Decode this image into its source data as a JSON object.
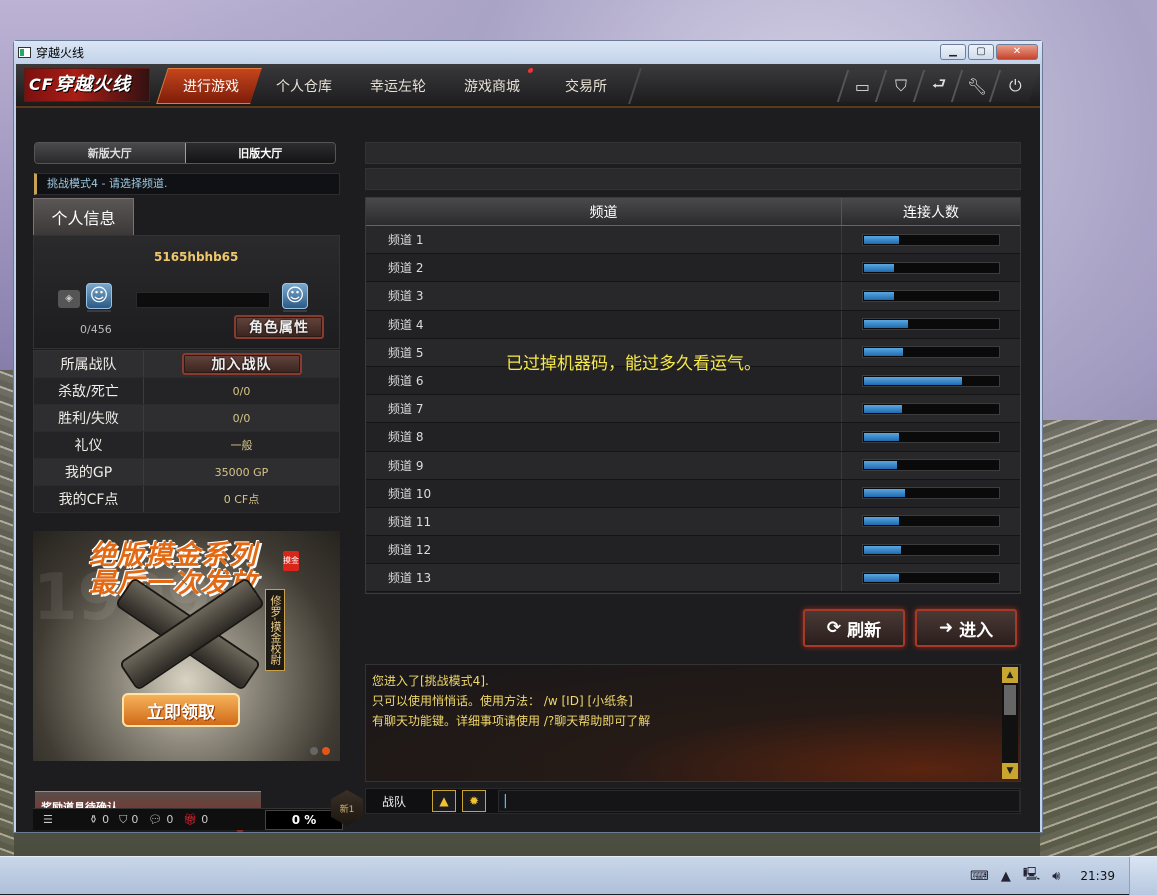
{
  "window": {
    "title": "穿越火线"
  },
  "nav": {
    "logo": "穿越火线",
    "tabs": [
      {
        "label": "进行游戏",
        "active": true
      },
      {
        "label": "个人仓库"
      },
      {
        "label": "幸运左轮"
      },
      {
        "label": "游戏商城",
        "badge": true
      },
      {
        "label": "交易所"
      }
    ],
    "icons": [
      "tv-icon",
      "shield-icon",
      "return-icon",
      "wrench-icon",
      "power-icon"
    ]
  },
  "lobby": {
    "new": "新版大厅",
    "old": "旧版大厅"
  },
  "mode_hint": "挑战模式4 - 请选择频道.",
  "profile": {
    "header": "个人信息",
    "name": "5165hbhb65",
    "xp": "0/456",
    "role_button": "角色属性"
  },
  "stats": {
    "team_label": "所属战队",
    "join_team": "加入战队",
    "rows": [
      {
        "k": "杀敌/死亡",
        "v": "0/0"
      },
      {
        "k": "胜利/失败",
        "v": "0/0"
      },
      {
        "k": "礼仪",
        "v": "一般"
      },
      {
        "k": "我的GP",
        "v": "35000 GP"
      },
      {
        "k": "我的CF点",
        "v": "0 CF点"
      }
    ]
  },
  "banner": {
    "line1": "绝版摸金系列",
    "line2": "最后一次发放",
    "tag": "摸金",
    "vertical": "修罗-摸金校尉",
    "cta": "立即领取"
  },
  "reward": "奖励道具待确认",
  "bottom": {
    "counts": [
      "0",
      "0",
      "0",
      "0"
    ],
    "percent": "0 %",
    "level": "新1"
  },
  "channels": {
    "header_name": "频道",
    "header_count": "连接人数",
    "rows": [
      {
        "name": "频道 1",
        "load": 0.26
      },
      {
        "name": "频道 2",
        "load": 0.22
      },
      {
        "name": "频道 3",
        "load": 0.22
      },
      {
        "name": "频道 4",
        "load": 0.32
      },
      {
        "name": "频道 5",
        "load": 0.29
      },
      {
        "name": "频道 6",
        "load": 0.72
      },
      {
        "name": "频道 7",
        "load": 0.28
      },
      {
        "name": "频道 8",
        "load": 0.26
      },
      {
        "name": "频道 9",
        "load": 0.24
      },
      {
        "name": "频道 10",
        "load": 0.3
      },
      {
        "name": "频道 11",
        "load": 0.26
      },
      {
        "name": "频道 12",
        "load": 0.27
      },
      {
        "name": "频道 13",
        "load": 0.26
      }
    ]
  },
  "overlay": "已过掉机器码，能过多久看运气。",
  "actions": {
    "refresh": "刷新",
    "enter": "进入"
  },
  "chat": {
    "lines": [
      "您进入了[挑战模式4].",
      "只可以使用悄悄话。使用方法： /w [ID] [小纸条]",
      "有聊天功能键。详细事项请使用 /?聊天帮助即可了解"
    ],
    "channel": "战队"
  },
  "taskbar": {
    "time": "21:39"
  }
}
